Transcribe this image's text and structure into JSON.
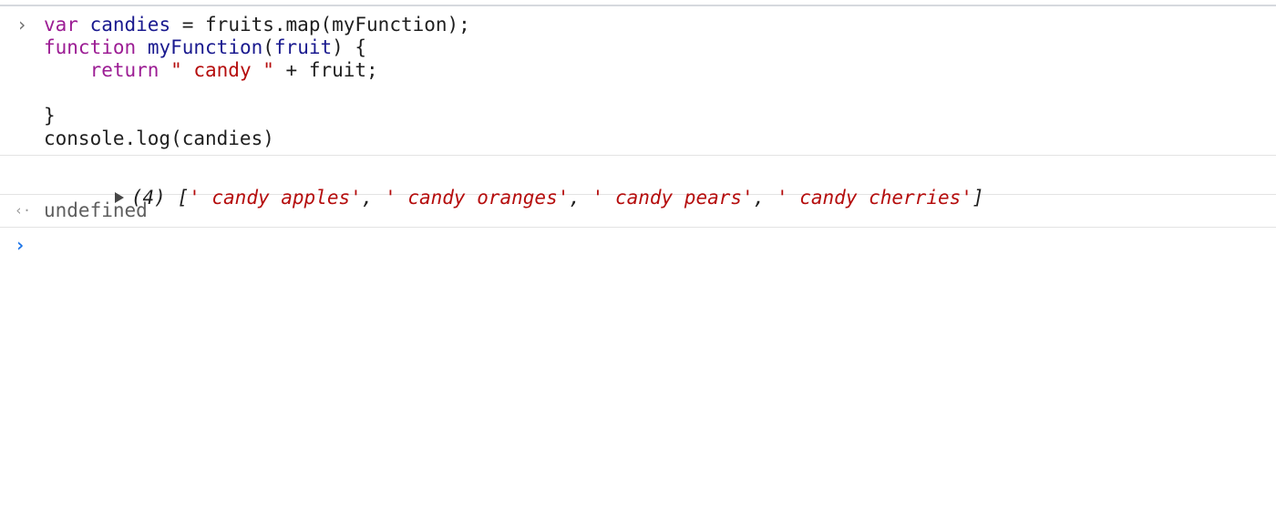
{
  "input": {
    "gutter_icon": "chevron-right-icon",
    "gutter_glyph": "›",
    "lines": [
      [
        {
          "t": "var",
          "c": "kw"
        },
        {
          "t": " ",
          "c": "plain"
        },
        {
          "t": "candies",
          "c": "var"
        },
        {
          "t": " = fruits.map(myFunction);",
          "c": "plain"
        }
      ],
      [
        {
          "t": "function",
          "c": "kw"
        },
        {
          "t": " ",
          "c": "plain"
        },
        {
          "t": "myFunction",
          "c": "var"
        },
        {
          "t": "(",
          "c": "plain"
        },
        {
          "t": "fruit",
          "c": "var"
        },
        {
          "t": ") {",
          "c": "plain"
        }
      ],
      [
        {
          "t": "    ",
          "c": "plain"
        },
        {
          "t": "return",
          "c": "kw"
        },
        {
          "t": " ",
          "c": "plain"
        },
        {
          "t": "\" candy \"",
          "c": "str"
        },
        {
          "t": " + fruit;",
          "c": "plain"
        }
      ],
      [
        {
          "t": "",
          "c": "plain"
        }
      ],
      [
        {
          "t": "}",
          "c": "plain"
        }
      ],
      [
        {
          "t": "console.log(candies)",
          "c": "plain"
        }
      ]
    ]
  },
  "output": {
    "expand_icon": "expand-triangle-icon",
    "count": "(4)",
    "open_bracket": "[",
    "close_bracket": "]",
    "separator": ", ",
    "items": [
      "' candy apples'",
      "' candy oranges'",
      "' candy pears'",
      "' candy cherries'"
    ]
  },
  "result": {
    "gutter_icon": "return-arrow-icon",
    "gutter_glyph": "‹·",
    "value": "undefined"
  },
  "prompt": {
    "icon": "prompt-chevron-icon",
    "glyph": "›"
  },
  "colors": {
    "keyword": "#9c1d94",
    "identifier": "#1a1a8f",
    "string": "#b50d0d",
    "prompt": "#1a73e8",
    "muted": "#5e5e5e"
  }
}
